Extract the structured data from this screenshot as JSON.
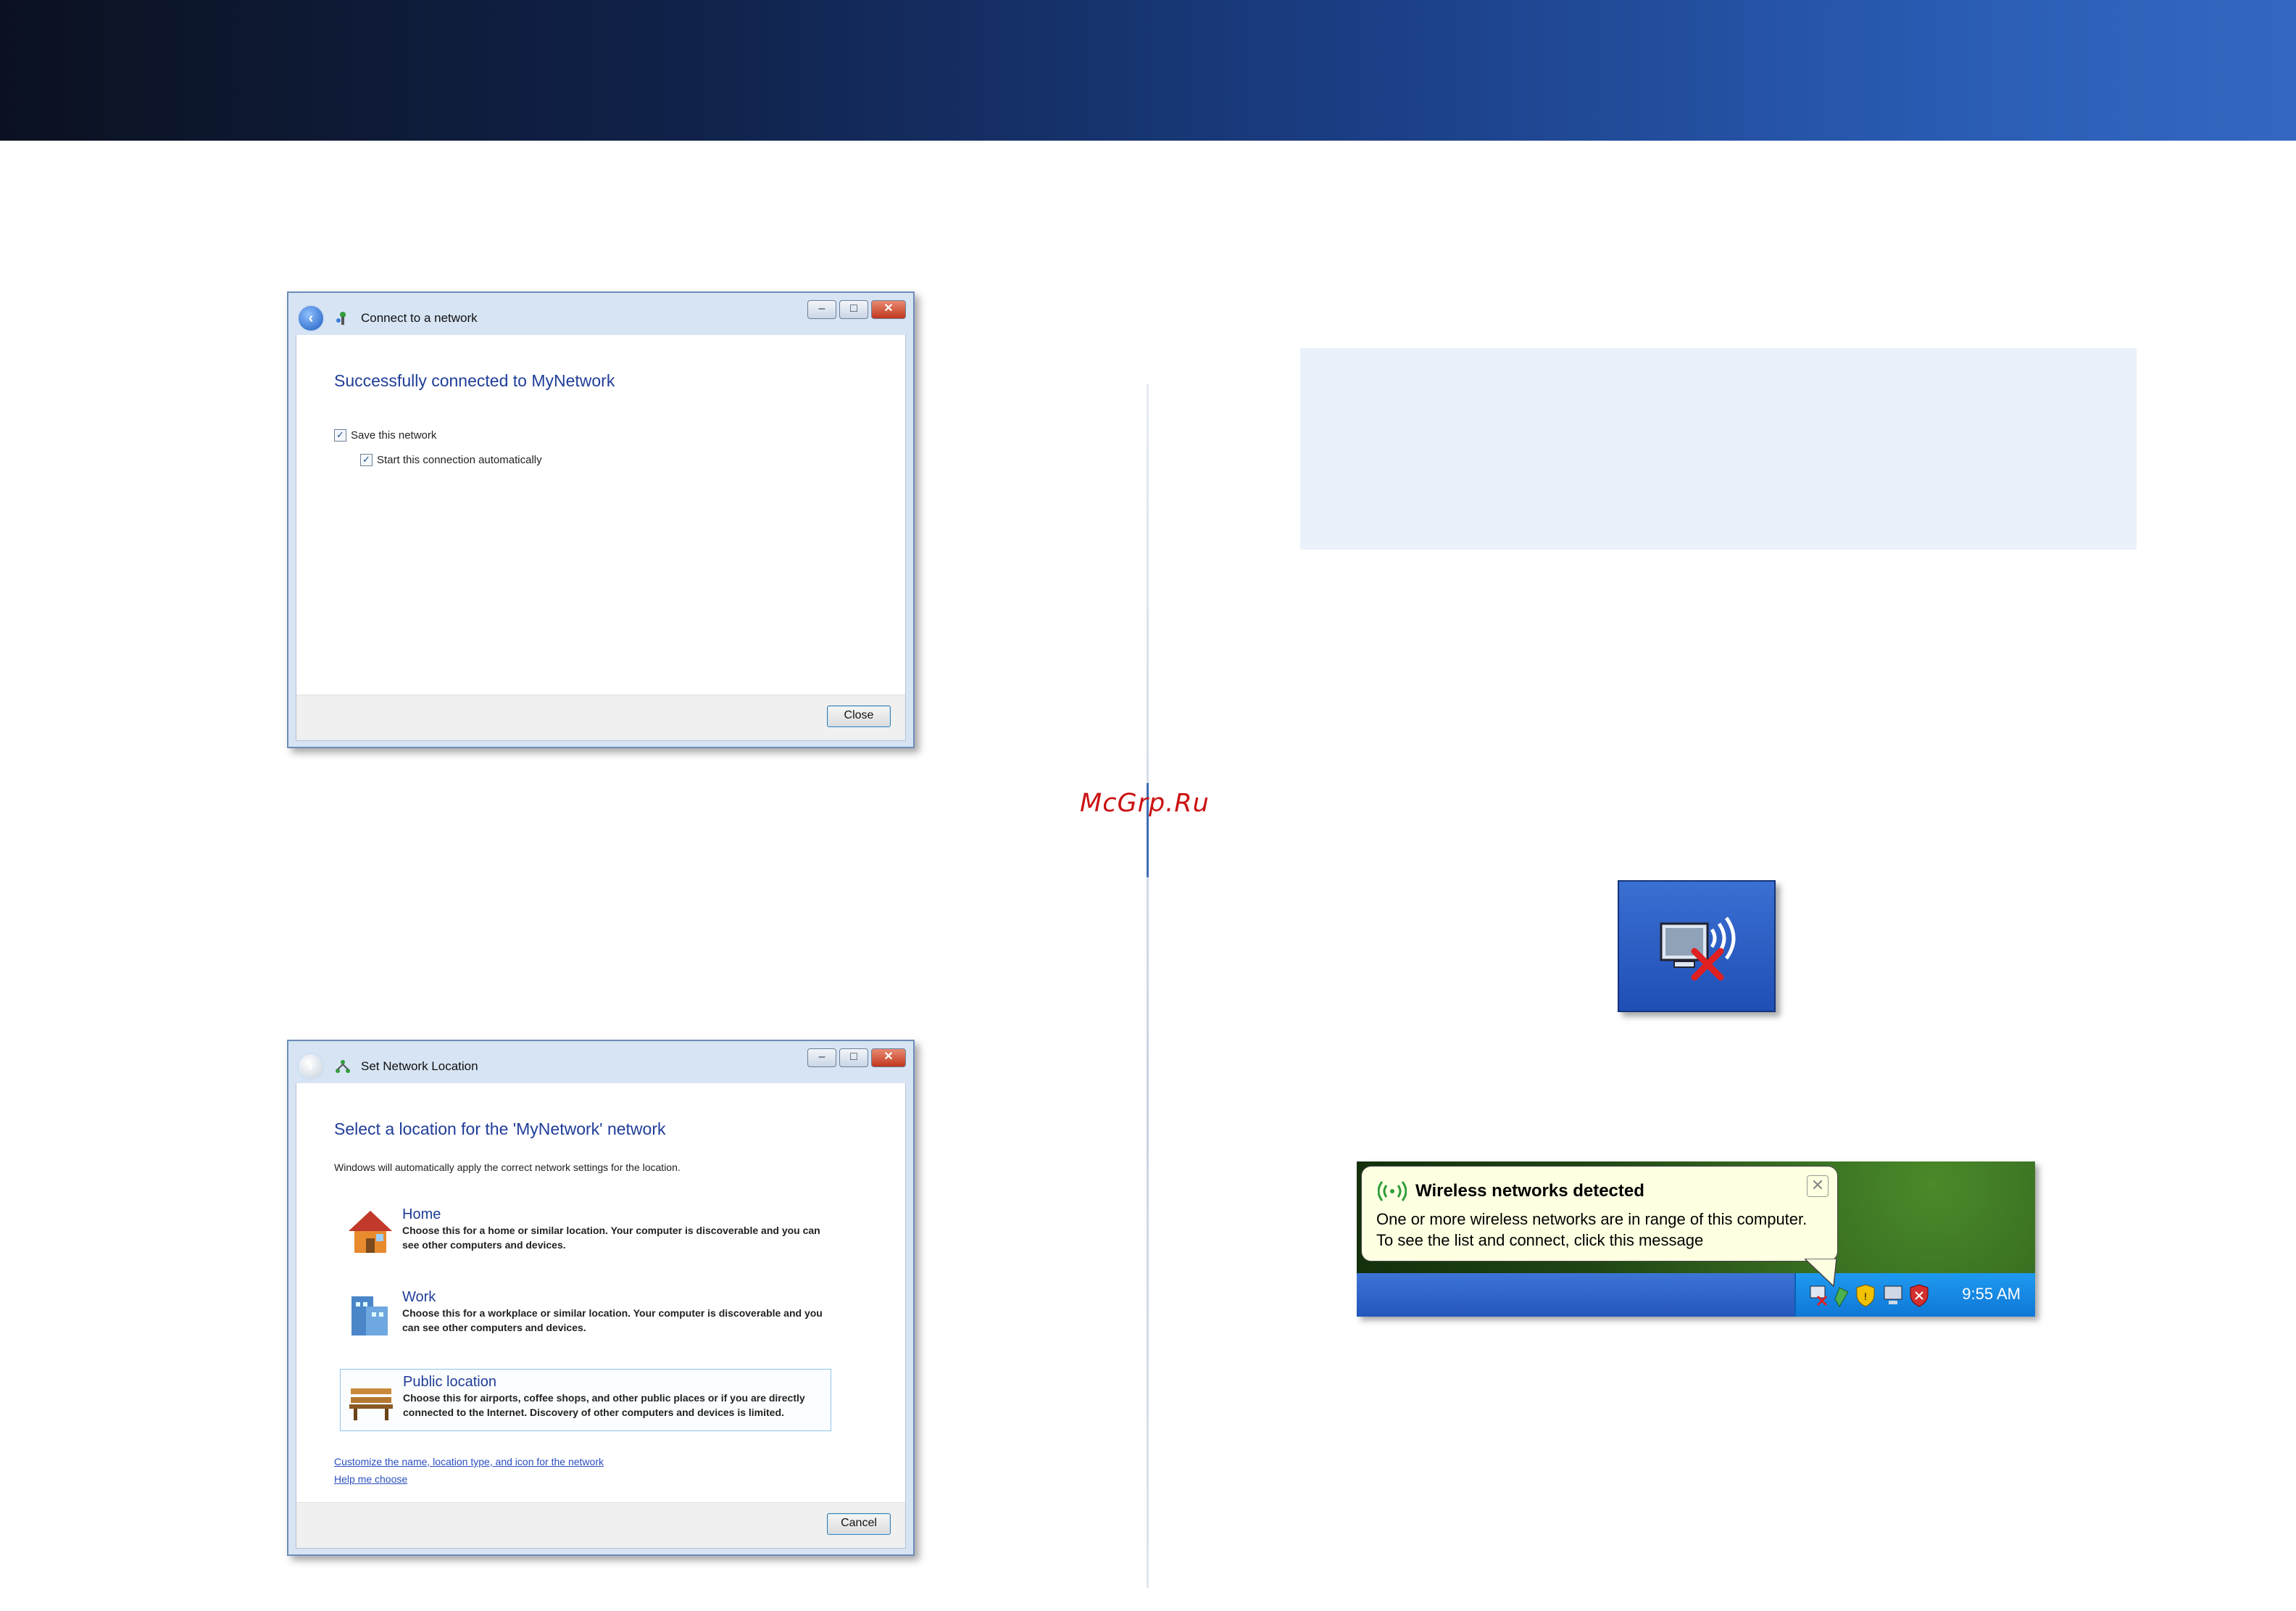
{
  "watermark": "McGrp.Ru",
  "dialog1": {
    "title": "Connect to a network",
    "heading": "Successfully connected to MyNetwork",
    "checkbox_save": "Save this network",
    "checkbox_auto": "Start this connection automatically",
    "close_button": "Close",
    "check_mark": "✓",
    "back_glyph": "‹"
  },
  "dialog2": {
    "title": "Set Network Location",
    "heading": "Select a location for the 'MyNetwork' network",
    "intro": "Windows will automatically apply the correct network settings for the location.",
    "options": [
      {
        "title": "Home",
        "desc": "Choose this for a home or similar location. Your computer is discoverable and you can see other computers and devices."
      },
      {
        "title": "Work",
        "desc": "Choose this for a workplace or similar location. Your computer is discoverable and you can see other computers and devices."
      },
      {
        "title": "Public location",
        "desc": "Choose this for airports, coffee shops, and other public places or if you are directly connected to the Internet. Discovery of other computers and devices is limited."
      }
    ],
    "link_customize": "Customize the name, location type, and icon for the network",
    "link_help": "Help me choose",
    "cancel_button": "Cancel"
  },
  "window_controls": {
    "minimize": "–",
    "maximize": "□",
    "close": "✕"
  },
  "balloon": {
    "title": "Wireless networks detected",
    "line1": "One or more wireless networks are in range of this computer.",
    "line2": "To see the list and connect, click this message",
    "close": "✕"
  },
  "taskbar": {
    "clock": "9:55 AM"
  }
}
